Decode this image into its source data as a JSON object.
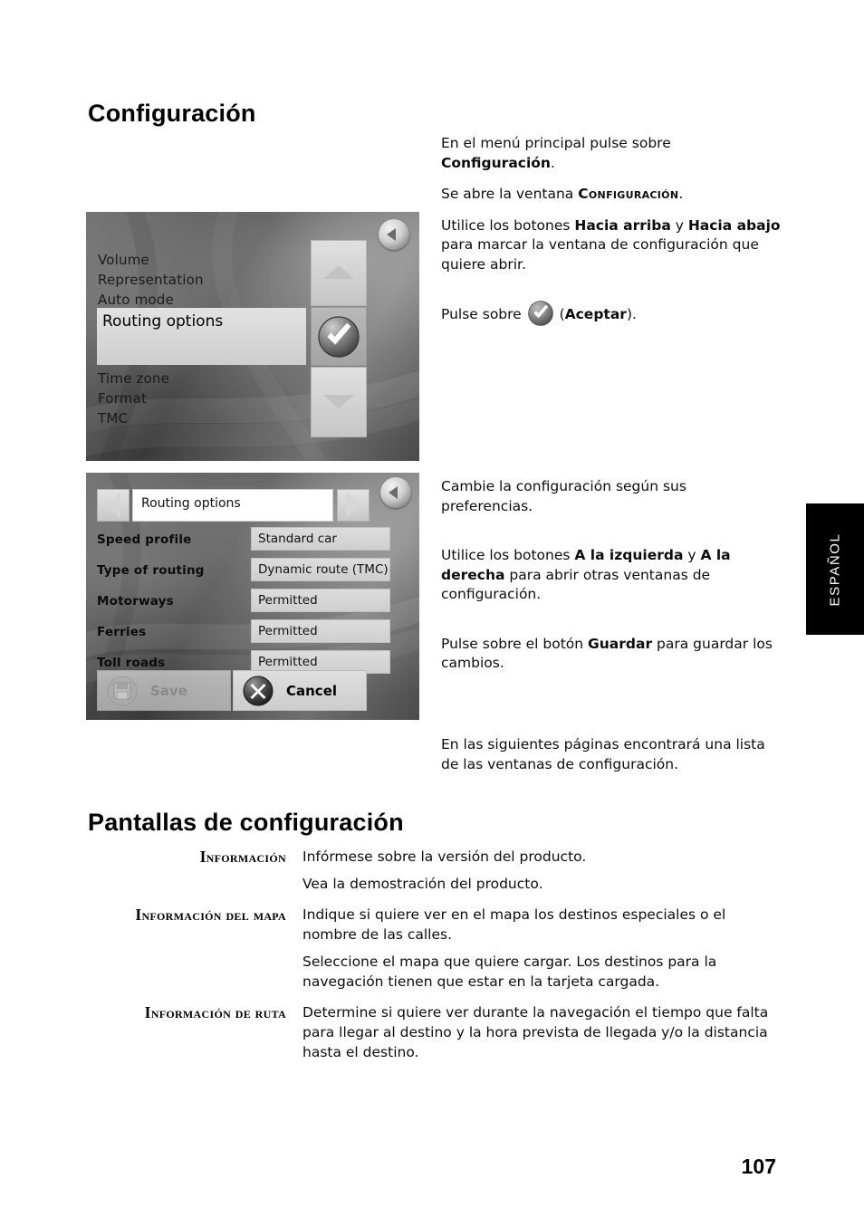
{
  "page": {
    "title": "Configuración",
    "section_title": "Pantallas de configuración",
    "number": "107",
    "language_tab": "ESPAÑOL"
  },
  "instructions_top": {
    "p1_prefix": "En el menú principal pulse sobre ",
    "p1_bold": "Configuración",
    "p1_suffix": ".",
    "p2_prefix": "Se abre la ventana ",
    "p2_smallcaps": "Configuración",
    "p2_suffix": ".",
    "p3_prefix": "Utilice los botones ",
    "p3_bold1": "Hacia arriba",
    "p3_mid": " y ",
    "p3_bold2": "Hacia abajo",
    "p3_suffix": " para marcar la ventana de configuración que quiere abrir.",
    "p4_prefix": "Pulse sobre ",
    "p4_open": " (",
    "p4_bold": "Aceptar",
    "p4_close": ")."
  },
  "instructions_mid": {
    "p1": "Cambie la configuración según sus preferencias.",
    "p2_prefix": "Utilice los botones ",
    "p2_bold1": "A la izquierda",
    "p2_mid": " y ",
    "p2_bold2": "A la derecha",
    "p2_suffix": " para abrir otras ventanas de configuración.",
    "p3_prefix": "Pulse sobre el botón ",
    "p3_bold": "Guardar",
    "p3_suffix": " para guardar los cambios."
  },
  "instructions_bottom": {
    "p1": "En las siguientes páginas encontrará una lista de las ventanas de configuración."
  },
  "device_settings_list": {
    "items_above": [
      "Volume",
      "Representation",
      "Auto mode"
    ],
    "selected_item": "Routing options",
    "items_below": [
      "Time zone",
      "Format",
      "TMC"
    ],
    "up_button": "up-arrow",
    "ok_button": "check-mark",
    "down_button": "down-arrow",
    "back_button": "back-arrow"
  },
  "device_routing_options": {
    "screen_title": "Routing options",
    "prev_button": "left-arrow",
    "next_button": "right-arrow",
    "back_button": "back-arrow",
    "rows": [
      {
        "label": "Speed profile",
        "value": "Standard car"
      },
      {
        "label": "Type of routing",
        "value": "Dynamic route (TMC)"
      },
      {
        "label": "Motorways",
        "value": "Permitted"
      },
      {
        "label": "Ferries",
        "value": "Permitted"
      },
      {
        "label": "Toll roads",
        "value": "Permitted"
      }
    ],
    "save_button": "Save",
    "cancel_button": "Cancel"
  },
  "settings_screens": [
    {
      "term": "Información",
      "paragraphs": [
        "Infórmese sobre la versión del producto.",
        "Vea la demostración del producto."
      ]
    },
    {
      "term": "Información del mapa",
      "paragraphs": [
        "Indique si quiere ver en el mapa los destinos especiales o el nombre de las calles.",
        "Seleccione el mapa que quiere cargar. Los destinos para la navegación tienen que estar en la tarjeta cargada."
      ]
    },
    {
      "term": "Información de ruta",
      "paragraphs": [
        "Determine si quiere ver durante la navegación el tiempo que falta para llegar al destino y la hora prevista de llegada y/o la distancia hasta el destino."
      ]
    }
  ],
  "colors": {
    "page_bg": "#ffffff",
    "text": "#0d0d0d",
    "tab_bg": "#000000",
    "tab_text": "#ffffff"
  }
}
